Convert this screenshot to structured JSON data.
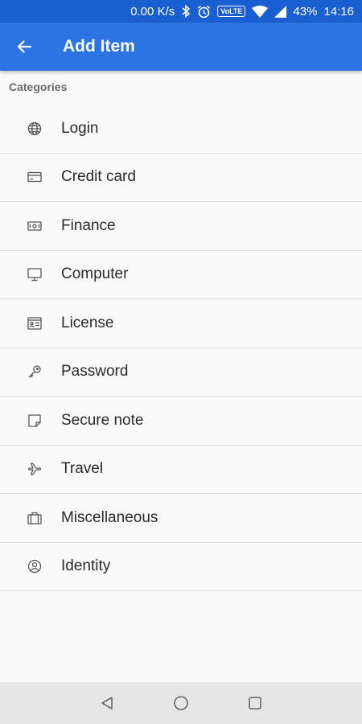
{
  "status_bar": {
    "speed": "0.00 K/s",
    "volte": "VoLTE",
    "battery": "43%",
    "time": "14:16"
  },
  "app_bar": {
    "title": "Add Item"
  },
  "categories": {
    "header": "Categories",
    "items": [
      {
        "label": "Login",
        "icon": "globe-icon"
      },
      {
        "label": "Credit card",
        "icon": "credit-card-icon"
      },
      {
        "label": "Finance",
        "icon": "banknote-icon"
      },
      {
        "label": "Computer",
        "icon": "monitor-icon"
      },
      {
        "label": "License",
        "icon": "id-card-icon"
      },
      {
        "label": "Password",
        "icon": "key-icon"
      },
      {
        "label": "Secure note",
        "icon": "note-icon"
      },
      {
        "label": "Travel",
        "icon": "airplane-icon"
      },
      {
        "label": "Miscellaneous",
        "icon": "briefcase-icon"
      },
      {
        "label": "Identity",
        "icon": "person-circle-icon"
      }
    ]
  },
  "colors": {
    "status_bar": "#1a5fd1",
    "app_bar": "#2b74e2",
    "background": "#fafafa",
    "nav_bar": "#e6e6e6"
  }
}
